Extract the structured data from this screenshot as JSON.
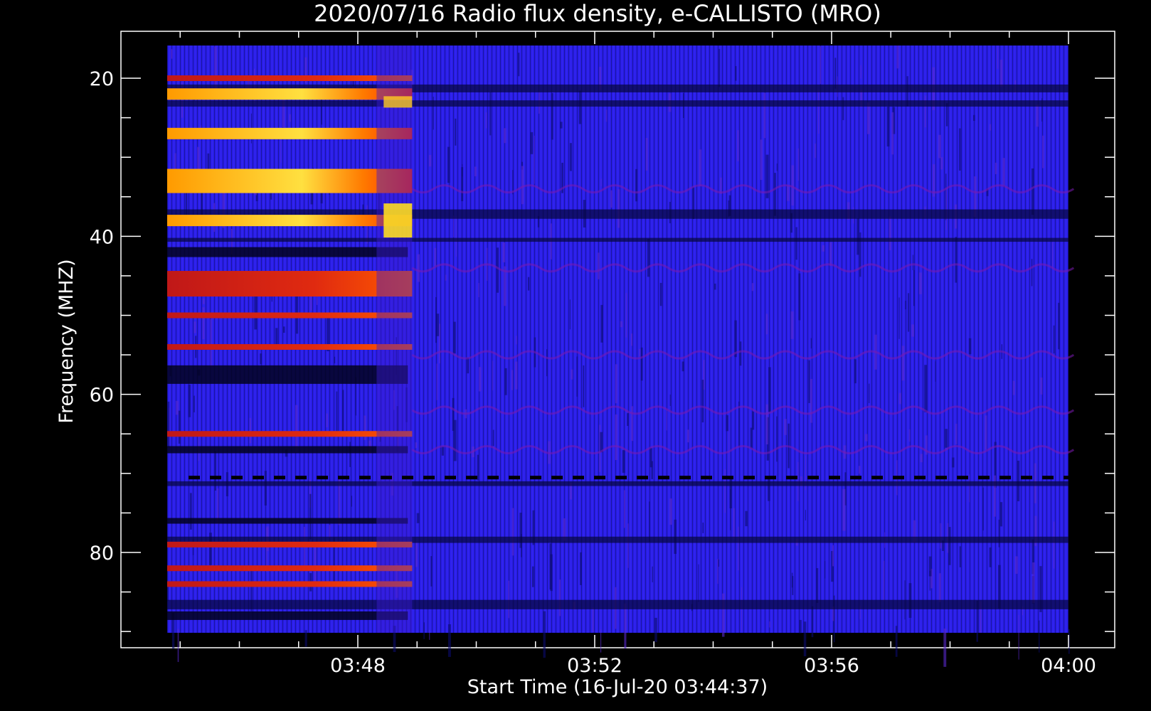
{
  "chart_data": {
    "type": "heatmap",
    "title": "2020/07/16  Radio flux density, e-CALLISTO (MRO)",
    "xlabel": "Start Time (16-Jul-20 03:44:37)",
    "ylabel": "Frequency (MHZ)",
    "x_ticks": [
      "03:48",
      "03:52",
      "03:56",
      "04:00"
    ],
    "y_ticks": [
      20,
      40,
      60,
      80
    ],
    "x_range": [
      "03:44:37",
      "04:00:00"
    ],
    "y_range": [
      16,
      92
    ],
    "y_axis_inverted": true,
    "colormap": [
      "#000000",
      "#1010c8",
      "#2a1ef0",
      "#b01010",
      "#ff3a00",
      "#ffa000",
      "#ffff40"
    ],
    "events": [
      {
        "start": "03:44:37",
        "end": "03:48:55",
        "description": "intense broadband emission bands (red/yellow)"
      },
      {
        "start": "03:48:55",
        "end": "04:00:00",
        "description": "background-level flux (blue)"
      }
    ],
    "emission_bands_mhz": [
      20,
      22,
      27,
      33,
      38,
      46,
      50,
      54,
      65,
      79,
      82,
      84
    ]
  }
}
